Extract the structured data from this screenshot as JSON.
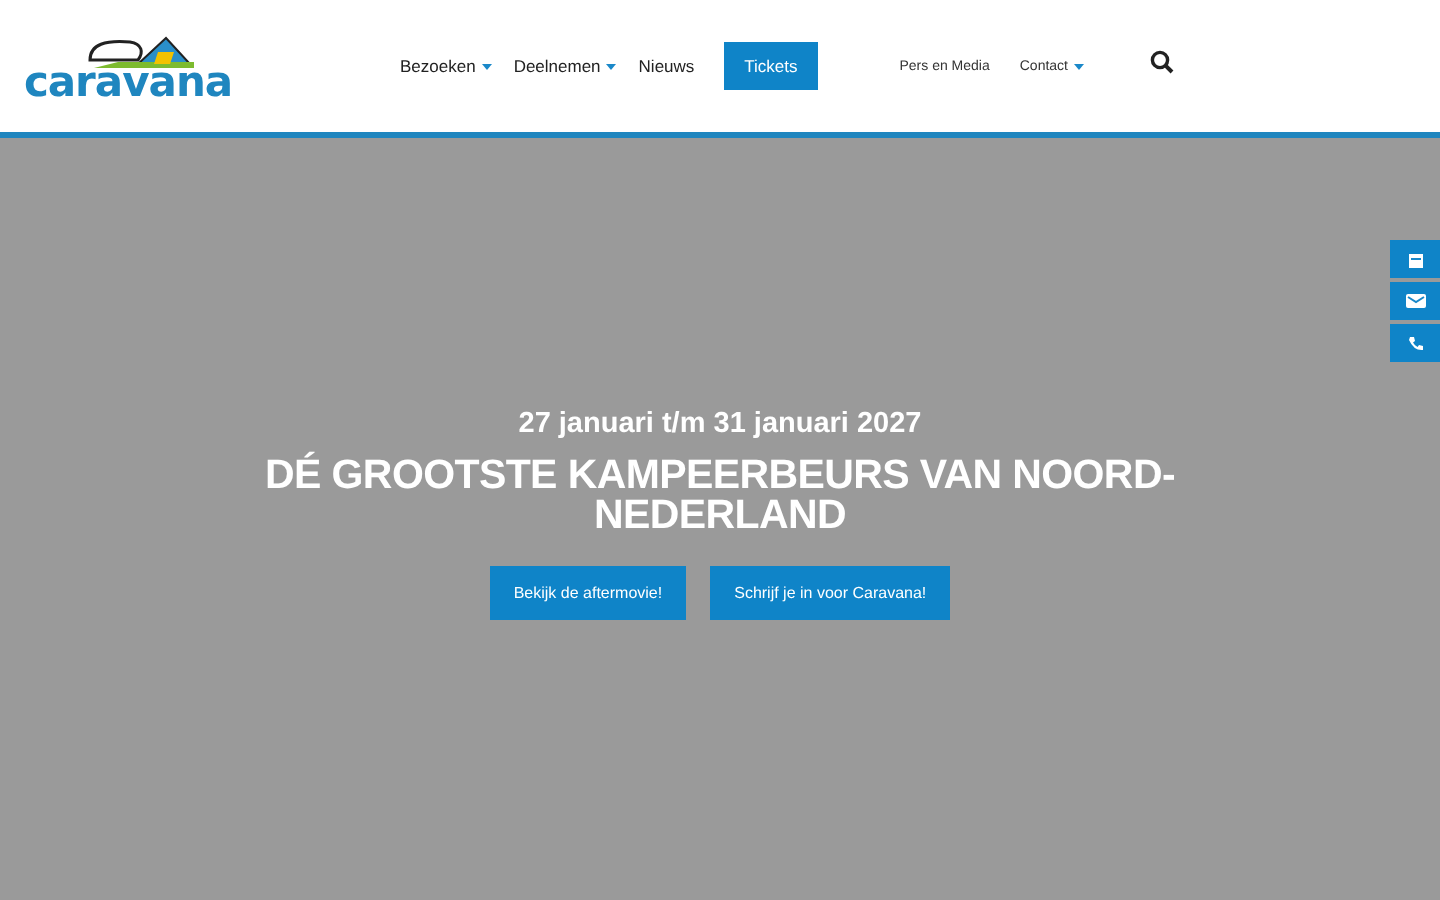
{
  "header": {
    "logo": "caravana",
    "nav": [
      {
        "label": "Bezoeken",
        "has_dropdown": true
      },
      {
        "label": "Deelnemen",
        "has_dropdown": true
      },
      {
        "label": "Nieuws",
        "has_dropdown": false
      }
    ],
    "cta": "Tickets",
    "secondary_nav": [
      {
        "label": "Pers en Media",
        "has_dropdown": false
      },
      {
        "label": "Contact",
        "has_dropdown": true
      }
    ]
  },
  "hero": {
    "date": "27 januari t/m 31 januari 2027",
    "title": "DÉ GROOTSTE KAMPEERBEURS VAN NOORD-NEDERLAND",
    "buttons": [
      "Bekijk de aftermovie!",
      "Schrijf je in voor Caravana!"
    ]
  }
}
